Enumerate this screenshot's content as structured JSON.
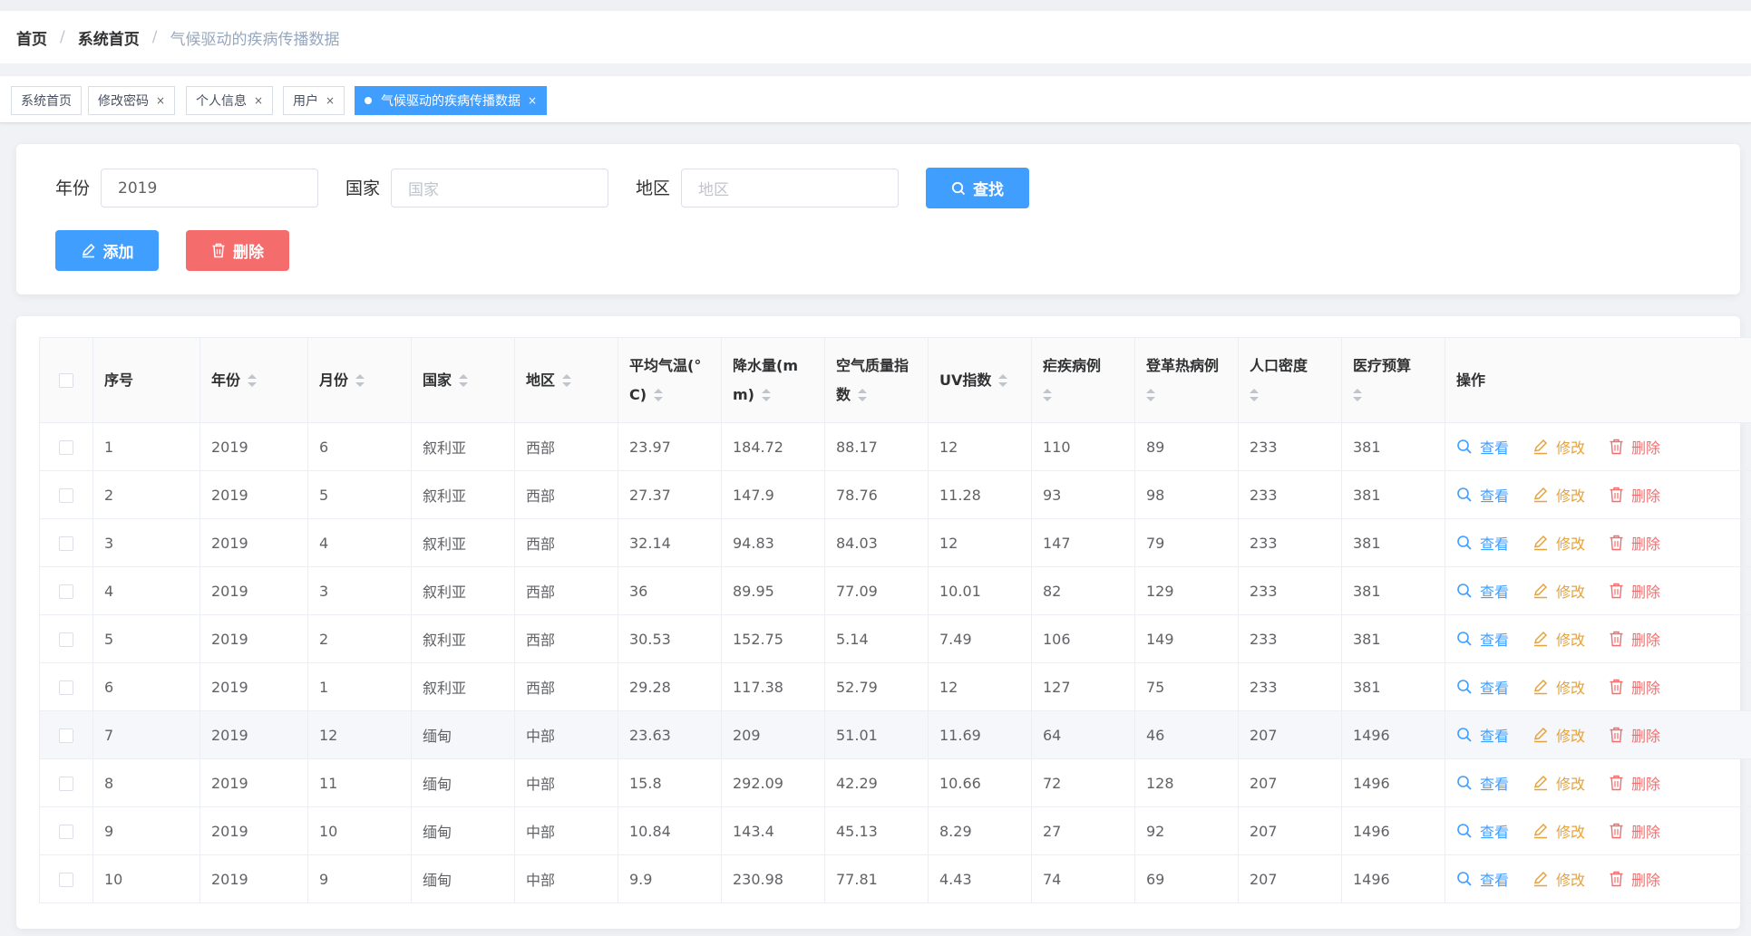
{
  "breadcrumb": [
    "首页",
    "系统首页",
    "气候驱动的疾病传播数据"
  ],
  "tabs": [
    {
      "label": "系统首页",
      "closable": false,
      "active": false
    },
    {
      "label": "修改密码",
      "closable": true,
      "active": false
    },
    {
      "label": "个人信息",
      "closable": true,
      "active": false
    },
    {
      "label": "用户",
      "closable": true,
      "active": false
    },
    {
      "label": "气候驱动的疾病传播数据",
      "closable": true,
      "active": true
    }
  ],
  "search": {
    "year_label": "年份",
    "year_value": "2019",
    "country_label": "国家",
    "country_placeholder": "国家",
    "region_label": "地区",
    "region_placeholder": "地区",
    "search_button": "查找"
  },
  "actions": {
    "add_button": "添加",
    "delete_button": "删除"
  },
  "table": {
    "headers": [
      "序号",
      "年份",
      "月份",
      "国家",
      "地区",
      "平均气温(°C)",
      "降水量(mm)",
      "空气质量指数",
      "UV指数",
      "疟疾病例",
      "登革热病例",
      "人口密度",
      "医疗预算",
      "操作"
    ],
    "header_lines": {
      "temp": [
        "平均气温(°",
        "C)"
      ],
      "rain": [
        "降水量(m",
        "m)"
      ],
      "aqi": [
        "空气质量指",
        "数"
      ]
    },
    "op_labels": {
      "view": "查看",
      "edit": "修改",
      "delete": "删除"
    },
    "rows": [
      [
        "1",
        "2019",
        "6",
        "叙利亚",
        "西部",
        "23.97",
        "184.72",
        "88.17",
        "12",
        "110",
        "89",
        "233",
        "381"
      ],
      [
        "2",
        "2019",
        "5",
        "叙利亚",
        "西部",
        "27.37",
        "147.9",
        "78.76",
        "11.28",
        "93",
        "98",
        "233",
        "381"
      ],
      [
        "3",
        "2019",
        "4",
        "叙利亚",
        "西部",
        "32.14",
        "94.83",
        "84.03",
        "12",
        "147",
        "79",
        "233",
        "381"
      ],
      [
        "4",
        "2019",
        "3",
        "叙利亚",
        "西部",
        "36",
        "89.95",
        "77.09",
        "10.01",
        "82",
        "129",
        "233",
        "381"
      ],
      [
        "5",
        "2019",
        "2",
        "叙利亚",
        "西部",
        "30.53",
        "152.75",
        "5.14",
        "7.49",
        "106",
        "149",
        "233",
        "381"
      ],
      [
        "6",
        "2019",
        "1",
        "叙利亚",
        "西部",
        "29.28",
        "117.38",
        "52.79",
        "12",
        "127",
        "75",
        "233",
        "381"
      ],
      [
        "7",
        "2019",
        "12",
        "缅甸",
        "中部",
        "23.63",
        "209",
        "51.01",
        "11.69",
        "64",
        "46",
        "207",
        "1496"
      ],
      [
        "8",
        "2019",
        "11",
        "缅甸",
        "中部",
        "15.8",
        "292.09",
        "42.29",
        "10.66",
        "72",
        "128",
        "207",
        "1496"
      ],
      [
        "9",
        "2019",
        "10",
        "缅甸",
        "中部",
        "10.84",
        "143.4",
        "45.13",
        "8.29",
        "27",
        "92",
        "207",
        "1496"
      ],
      [
        "10",
        "2019",
        "9",
        "缅甸",
        "中部",
        "9.9",
        "230.98",
        "77.81",
        "4.43",
        "74",
        "69",
        "207",
        "1496"
      ]
    ],
    "highlighted_row": 6
  }
}
